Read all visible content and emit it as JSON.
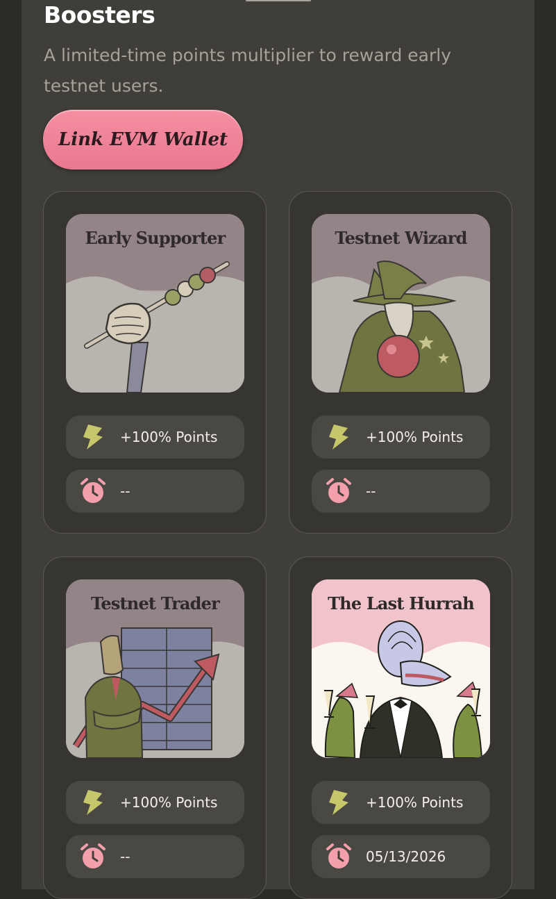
{
  "header": {
    "title": "Boosters",
    "subtitle": "A limited-time points multiplier to reward early testnet users."
  },
  "actions": {
    "link_wallet_label": "Link EVM Wallet"
  },
  "colors": {
    "accent_pink": "#f08aa0",
    "points_icon": "#c6c66a",
    "timer_icon": "#f4a0ac",
    "card_bg": "#363532",
    "pill_bg": "#4a4843"
  },
  "boosters": [
    {
      "title": "Early Supporter",
      "points": "+100% Points",
      "timer": "--",
      "active": false,
      "icons": {
        "points": "lightning-icon",
        "timer": "alarm-clock-icon"
      }
    },
    {
      "title": "Testnet Wizard",
      "points": "+100% Points",
      "timer": "--",
      "active": false,
      "icons": {
        "points": "lightning-icon",
        "timer": "alarm-clock-icon"
      }
    },
    {
      "title": "Testnet Trader",
      "points": "+100% Points",
      "timer": "--",
      "active": false,
      "icons": {
        "points": "lightning-icon",
        "timer": "alarm-clock-icon"
      }
    },
    {
      "title": "The Last Hurrah",
      "points": "+100% Points",
      "timer": "05/13/2026",
      "active": true,
      "icons": {
        "points": "lightning-icon",
        "timer": "alarm-clock-icon"
      }
    }
  ]
}
